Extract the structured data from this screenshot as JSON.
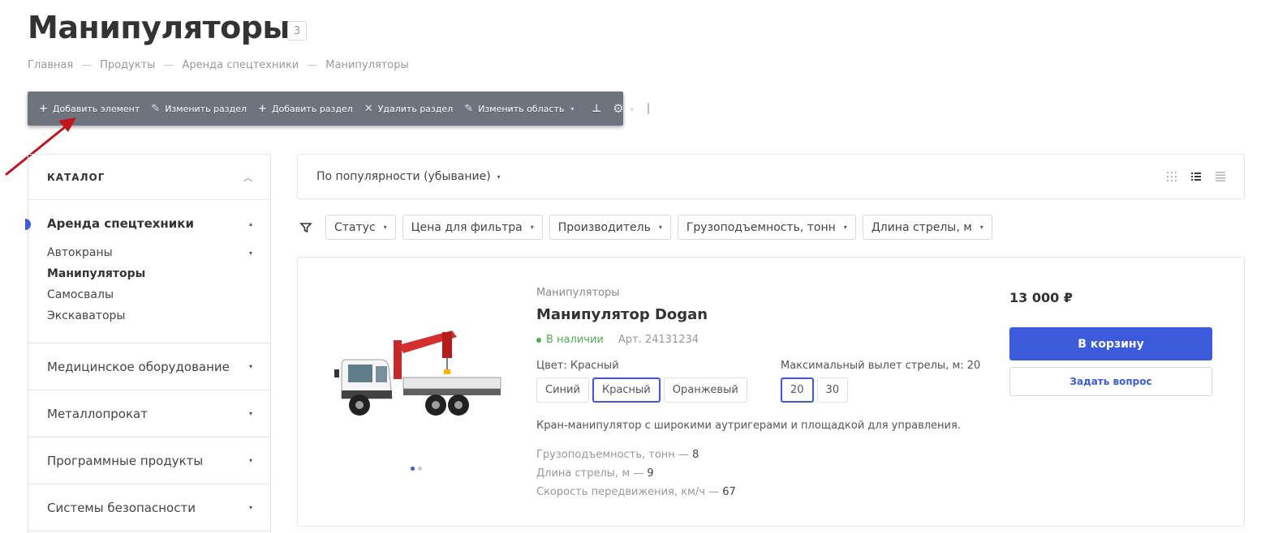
{
  "page": {
    "title": "Манипуляторы",
    "count": "3"
  },
  "breadcrumb": [
    "Главная",
    "Продукты",
    "Аренда спецтехники",
    "Манипуляторы"
  ],
  "admin_toolbar": {
    "add_element": "Добавить элемент",
    "edit_section": "Изменить раздел",
    "add_section": "Добавить раздел",
    "delete_section": "Удалить раздел",
    "edit_area": "Изменить область"
  },
  "sidebar": {
    "header": "КАТАЛОГ",
    "active_section": "Аренда спецтехники",
    "sub_items": [
      "Автокраны",
      "Манипуляторы",
      "Самосвалы",
      "Экскаваторы"
    ],
    "sections": [
      "Медицинское оборудование",
      "Металлопрокат",
      "Программные продукты",
      "Системы безопасности"
    ]
  },
  "sort": {
    "label": "По популярности (убывание)"
  },
  "filters": [
    "Статус",
    "Цена для фильтра",
    "Производитель",
    "Грузоподъемность, тонн",
    "Длина стрелы, м"
  ],
  "product": {
    "category": "Манипуляторы",
    "name": "Манипулятор Dogan",
    "status": "В наличии",
    "article": "Арт. 24131234",
    "color_label": "Цвет: Красный",
    "colors": [
      "Синий",
      "Красный",
      "Оранжевый"
    ],
    "selected_color": "Красный",
    "boom_label": "Максимальный вылет стрелы, м: 20",
    "boom_options": [
      "20",
      "30"
    ],
    "selected_boom": "20",
    "description": "Кран-манипулятор с широкими аутригерами и площадкой для управления.",
    "props": [
      {
        "name": "Грузоподъемность, тонн",
        "value": "8"
      },
      {
        "name": "Длина стрелы, м",
        "value": "9"
      },
      {
        "name": "Скорость передвижения, км/ч",
        "value": "67"
      }
    ],
    "price": "13 000 ₽",
    "cart_button": "В корзину",
    "ask_button": "Задать вопрос"
  },
  "colors": {
    "accent": "#3b5bdb",
    "in_stock": "#4caf50",
    "toolbar_bg": "#6e747e",
    "annotation_arrow": "#c0141c"
  }
}
